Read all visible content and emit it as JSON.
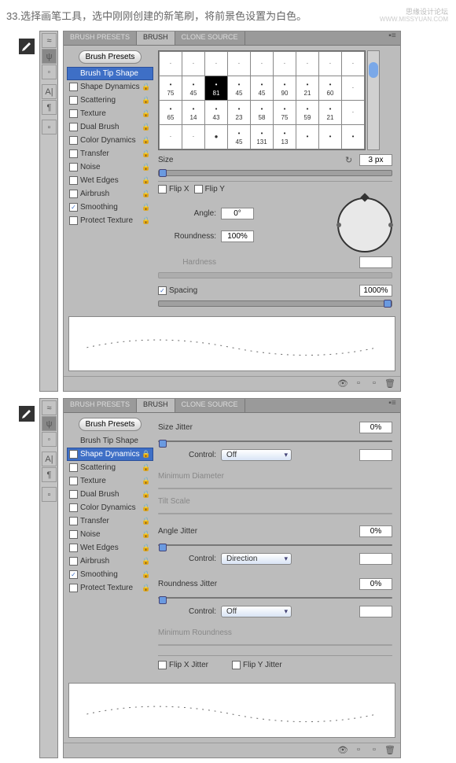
{
  "caption": "33.选择画笔工具，选中刚刚创建的新笔刷，将前景色设置为白色。",
  "watermark": "思缘设计论坛",
  "watermark2": "WWW.MISSYUAN.COM",
  "tabs": {
    "presets": "BRUSH PRESETS",
    "brush": "BRUSH",
    "clone": "CLONE SOURCE"
  },
  "presetBtn": "Brush Presets",
  "options": [
    {
      "label": "Brush Tip Shape",
      "check": null,
      "lock": false
    },
    {
      "label": "Shape Dynamics",
      "check": false,
      "lock": true
    },
    {
      "label": "Scattering",
      "check": false,
      "lock": true
    },
    {
      "label": "Texture",
      "check": false,
      "lock": true
    },
    {
      "label": "Dual Brush",
      "check": false,
      "lock": true
    },
    {
      "label": "Color Dynamics",
      "check": false,
      "lock": true
    },
    {
      "label": "Transfer",
      "check": false,
      "lock": true
    },
    {
      "label": "Noise",
      "check": false,
      "lock": true
    },
    {
      "label": "Wet Edges",
      "check": false,
      "lock": true
    },
    {
      "label": "Airbrush",
      "check": false,
      "lock": true
    },
    {
      "label": "Smoothing",
      "check": true,
      "lock": true
    },
    {
      "label": "Protect Texture",
      "check": false,
      "lock": true
    }
  ],
  "brushGrid": [
    [
      ".",
      ".",
      ".",
      ".",
      ".",
      ".",
      ".",
      ".",
      "."
    ],
    [
      "75",
      "45",
      "81",
      "45",
      "45",
      "90",
      "21",
      "60",
      "."
    ],
    [
      "65",
      "14",
      "43",
      "23",
      "58",
      "75",
      "59",
      "21",
      "."
    ],
    [
      ".",
      ".",
      "●",
      "45",
      "131",
      "13",
      "",
      "",
      ""
    ]
  ],
  "selIdx": 11,
  "size": {
    "label": "Size",
    "value": "3 px"
  },
  "flipX": "Flip X",
  "flipY": "Flip Y",
  "angle": {
    "label": "Angle:",
    "value": "0°"
  },
  "roundness": {
    "label": "Roundness:",
    "value": "100%"
  },
  "hardness": {
    "label": "Hardness",
    "value": ""
  },
  "spacing": {
    "label": "Spacing",
    "value": "1000%",
    "checked": true
  },
  "panel2": {
    "sizeJitter": {
      "label": "Size Jitter",
      "value": "0%"
    },
    "control": {
      "label": "Control:",
      "off": "Off",
      "direction": "Direction"
    },
    "minDiam": "Minimum Diameter",
    "tiltScale": "Tilt Scale",
    "angleJitter": {
      "label": "Angle Jitter",
      "value": "0%"
    },
    "roundJitter": {
      "label": "Roundness Jitter",
      "value": "0%"
    },
    "minRound": "Minimum Roundness",
    "flipXJ": "Flip X Jitter",
    "flipYJ": "Flip Y Jitter"
  }
}
